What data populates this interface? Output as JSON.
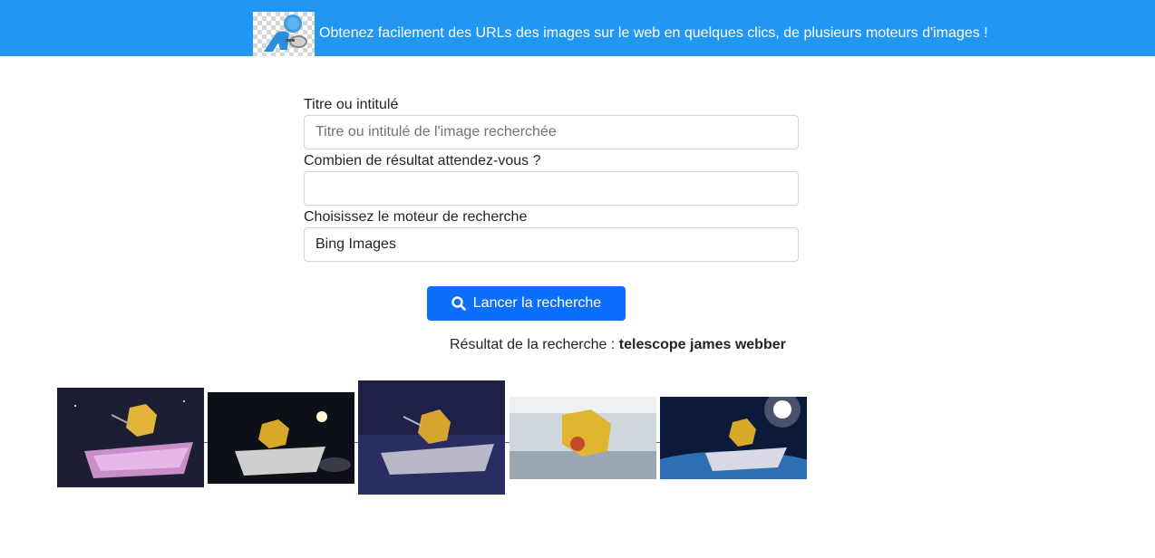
{
  "header": {
    "logo_icon": "person-magnifier-logo-icon",
    "tagline": "Obtenez facilement des URLs des images sur le web en quelques clics, de plusieurs moteurs d'images !"
  },
  "form": {
    "title_label": "Titre ou intitulé",
    "title_placeholder": "Titre ou intitulé de l'image recherchée",
    "count_label": "Combien de résultat attendez-vous ?",
    "count_value": "",
    "engine_label": "Choisissez le moteur de recherche",
    "engine_value": "Bing Images",
    "search_button": "Lancer la recherche",
    "search_icon": "search-icon"
  },
  "results": {
    "prefix": "Résultat de la recherche : ",
    "query": "telescope james webber",
    "images": [
      {
        "subject": "james-webb-telescope-space-pink-shield"
      },
      {
        "subject": "james-webb-telescope-space-sun"
      },
      {
        "subject": "james-webb-telescope-blue-space"
      },
      {
        "subject": "james-webb-telescope-clean-room"
      },
      {
        "subject": "james-webb-telescope-earth-orbit"
      }
    ]
  },
  "colors": {
    "header_bg": "#2196f3",
    "button_bg": "#0d6efd",
    "text": "#212529"
  }
}
